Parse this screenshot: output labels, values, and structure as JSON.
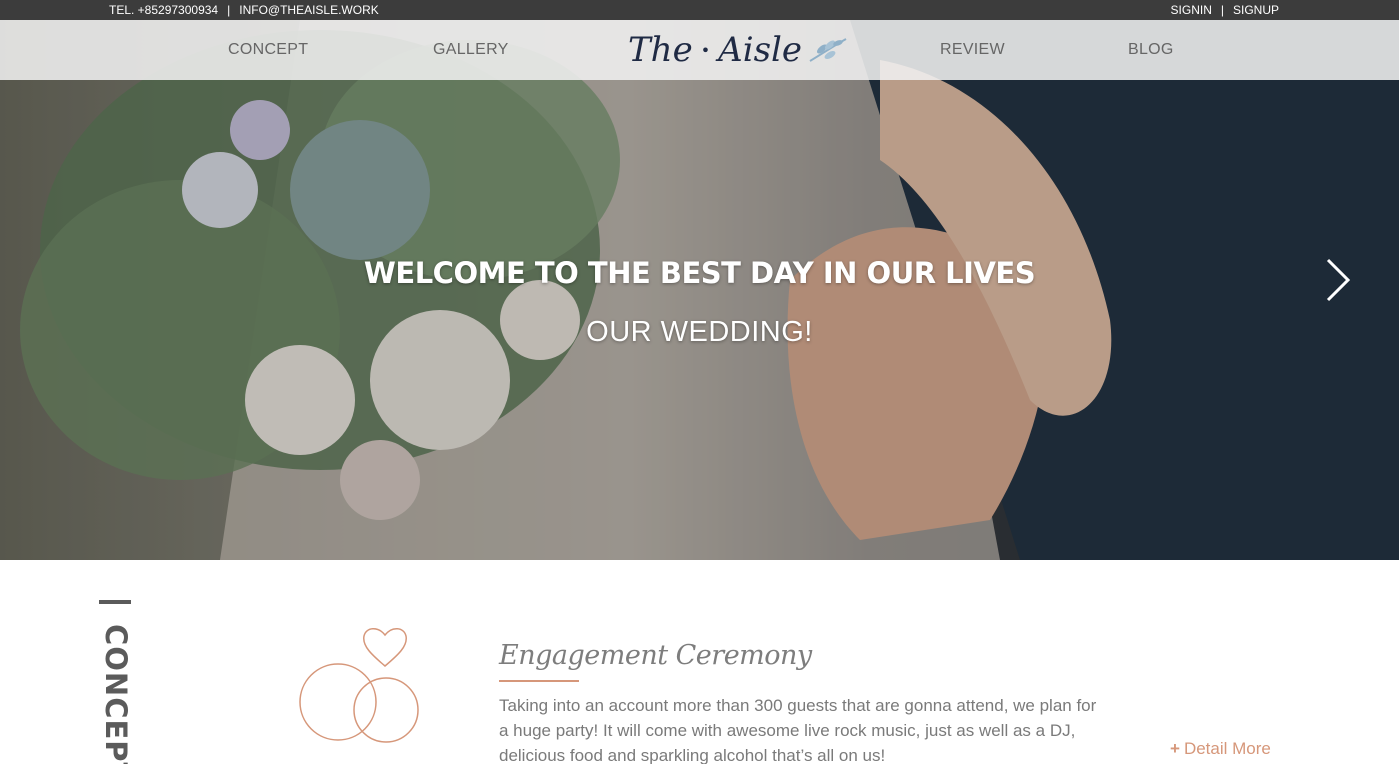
{
  "topbar": {
    "phone": "TEL. +85297300934",
    "email": "INFO@THEAISLE.WORK",
    "signin": "SIGNIN",
    "signup": "SIGNUP"
  },
  "nav": {
    "items": [
      "CONCEPT",
      "GALLERY",
      "REVIEW",
      "BLOG"
    ],
    "logo_left": "The",
    "logo_dot": "•",
    "logo_right": "Aisle"
  },
  "hero": {
    "title": "WELCOME TO THE BEST DAY IN OUR LIVES",
    "subtitle": "OUR WEDDING!",
    "next_icon": "chevron-right-icon"
  },
  "section": {
    "side_label": "CONCEPT",
    "card_title": "Engagement Ceremony",
    "card_text": "Taking into an account more than 300 guests that are gonna attend, we plan for a huge party! It will come with awesome live rock music, just as well as a DJ, delicious food and sparkling alcohol that’s all on us!",
    "detail_label": "Detail More",
    "detail_icon": "plus-icon"
  },
  "colors": {
    "accent": "#d6977a",
    "topbar": "#3c3c3c",
    "logo": "#1f2a44",
    "leaf": "#8fb0c8"
  }
}
